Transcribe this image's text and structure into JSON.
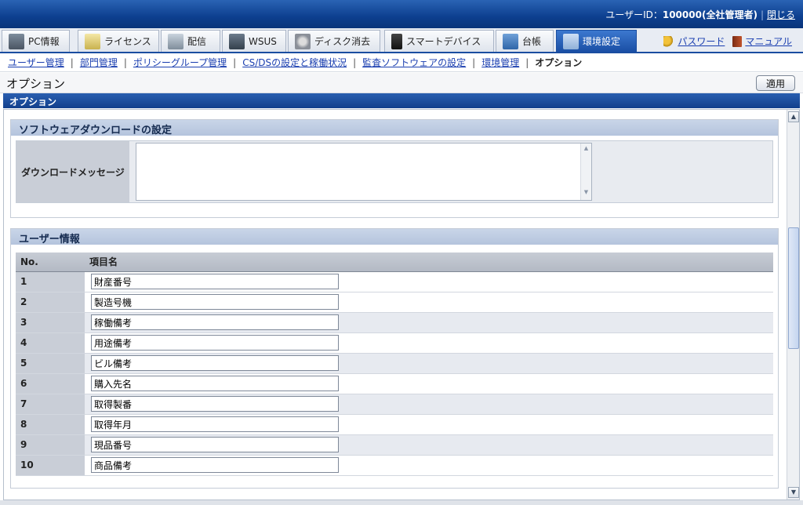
{
  "header": {
    "user_label": "ユーザーID：",
    "user_value": "100000(全社管理者)",
    "close_link": "閉じる",
    "separator": "|"
  },
  "tabs": [
    {
      "label": "PC情報",
      "icon": "pc-icon"
    },
    {
      "label": "ライセンス",
      "icon": "license-icon"
    },
    {
      "label": "配信",
      "icon": "distribution-icon"
    },
    {
      "label": "WSUS",
      "icon": "wsus-icon"
    },
    {
      "label": "ディスク消去",
      "icon": "disk-erase-icon"
    },
    {
      "label": "スマートデバイス",
      "icon": "smart-device-icon"
    },
    {
      "label": "台帳",
      "icon": "ledger-icon"
    },
    {
      "label": "環境設定",
      "icon": "tools-icon",
      "active": true
    }
  ],
  "right_links": {
    "password": "パスワード",
    "manual": "マニュアル"
  },
  "subnav": {
    "items": [
      "ユーザー管理",
      "部門管理",
      "ポリシーグループ管理",
      "CS/DSの設定と稼働状況",
      "監査ソフトウェアの設定",
      "環境管理"
    ],
    "current": "オプション",
    "divider": "|"
  },
  "page": {
    "title": "オプション",
    "apply_button": "適用",
    "section_title": "オプション"
  },
  "download_section": {
    "title": "ソフトウェアダウンロードの設定",
    "label": "ダウンロードメッセージ",
    "value": ""
  },
  "user_info": {
    "title": "ユーザー情報",
    "columns": [
      "No.",
      "項目名"
    ],
    "rows": [
      {
        "no": "1",
        "value": "財産番号"
      },
      {
        "no": "2",
        "value": "製造号機"
      },
      {
        "no": "3",
        "value": "稼働備考"
      },
      {
        "no": "4",
        "value": "用途備考"
      },
      {
        "no": "5",
        "value": "ビル備考"
      },
      {
        "no": "6",
        "value": "購入先名"
      },
      {
        "no": "7",
        "value": "取得製番"
      },
      {
        "no": "8",
        "value": "取得年月"
      },
      {
        "no": "9",
        "value": "現品番号"
      },
      {
        "no": "10",
        "value": "商品備考"
      }
    ]
  },
  "colors": {
    "header_blue": "#0d3f8f",
    "active_tab": "#1a4fa5",
    "link": "#1b3fb0",
    "panel_header": "#b4c4dd"
  }
}
